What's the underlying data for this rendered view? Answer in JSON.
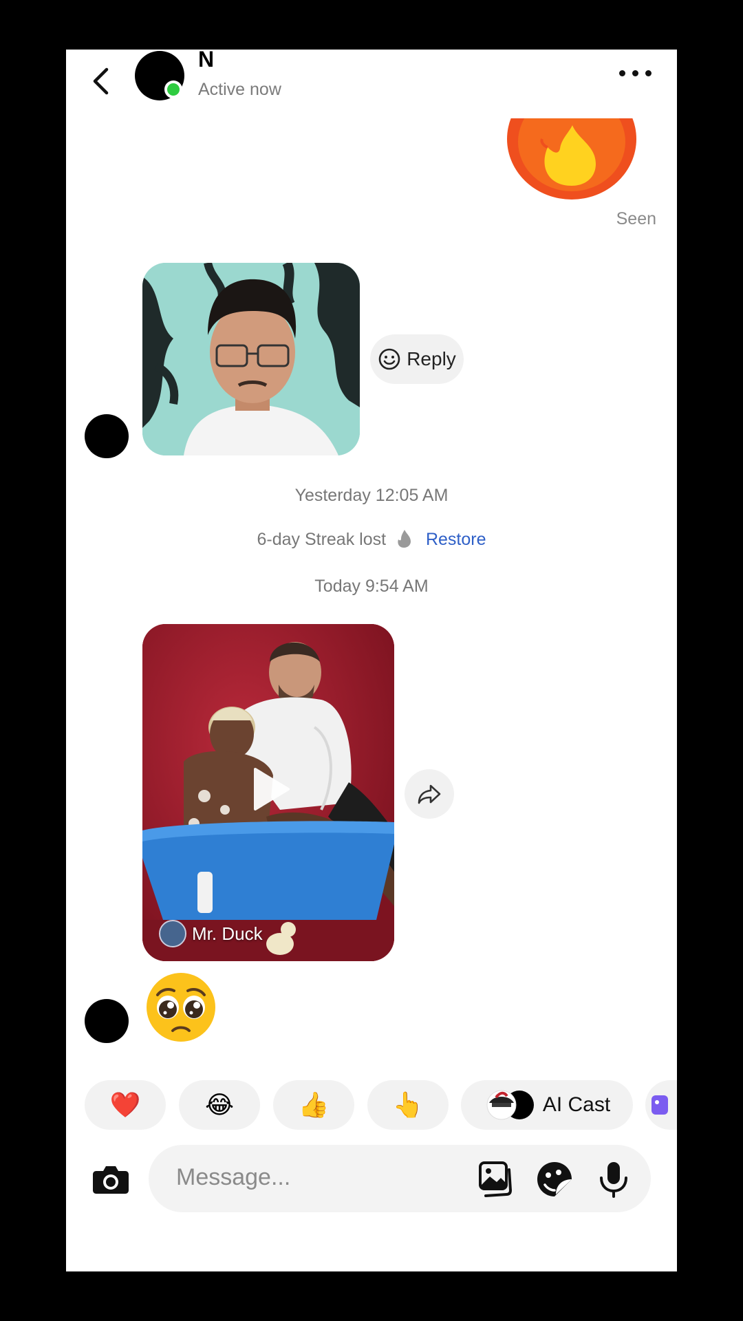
{
  "header": {
    "contact_name": "N",
    "status": "Active now"
  },
  "messages": {
    "seen_label": "Seen",
    "reply_label": "Reply",
    "timestamp_1": "Yesterday 12:05 AM",
    "streak_text": "6-day Streak lost",
    "restore_label": "Restore",
    "timestamp_2": "Today 9:54 AM",
    "video_author": "Mr. Duck",
    "emoji": "🥺"
  },
  "quick_reactions": {
    "heart": "❤️",
    "laugh": "😂",
    "thumbs_up": "👍",
    "point": "👆",
    "ai_cast_label": "AI Cast"
  },
  "composer": {
    "placeholder": "Message..."
  },
  "colors": {
    "online": "#2ecc40",
    "restore_link": "#2e5fc7"
  }
}
